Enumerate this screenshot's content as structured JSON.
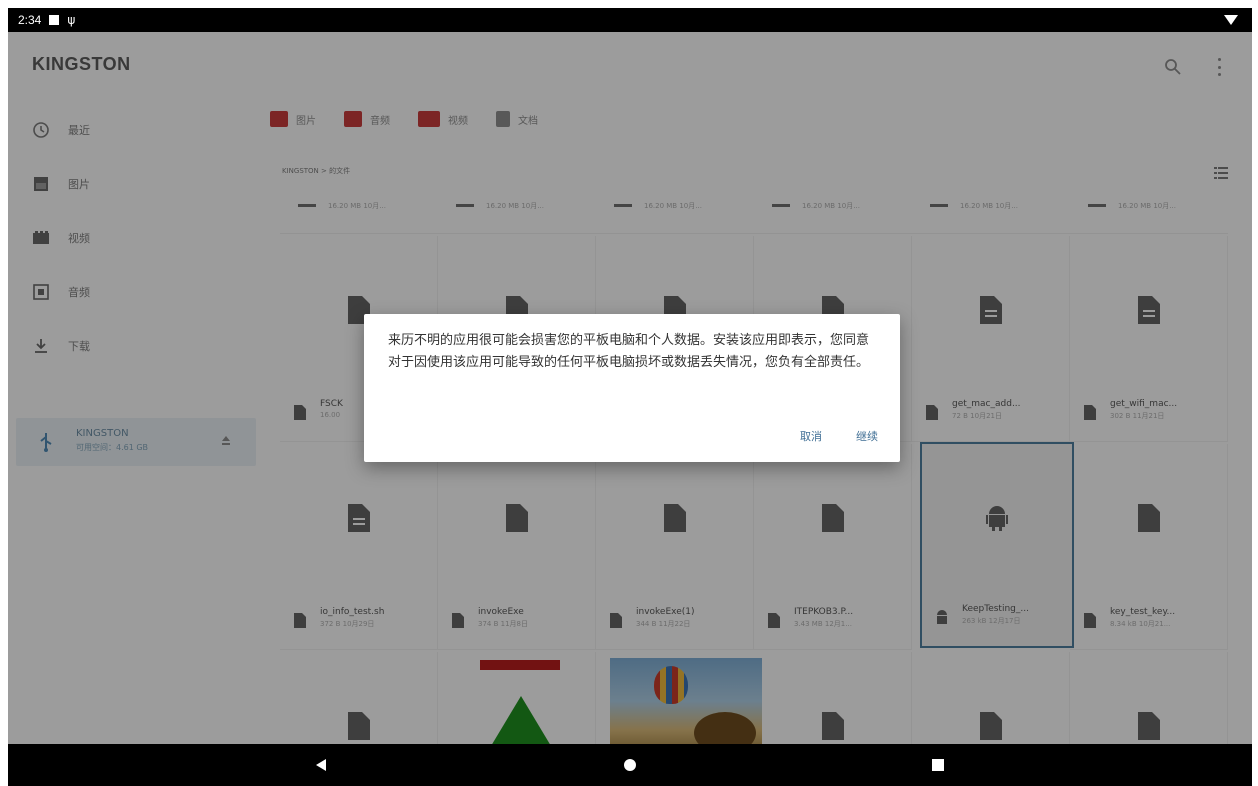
{
  "status_bar": {
    "time": "2:34"
  },
  "app": {
    "title": "KINGSTON"
  },
  "drawer": {
    "items": [
      {
        "label": "最近",
        "icon": "clock-icon"
      },
      {
        "label": "图片",
        "icon": "image-icon"
      },
      {
        "label": "视频",
        "icon": "video-icon"
      },
      {
        "label": "音频",
        "icon": "audio-icon"
      },
      {
        "label": "下载",
        "icon": "download-icon"
      }
    ],
    "root": {
      "name": "KINGSTON",
      "free": "可用空间：4.61 GB"
    }
  },
  "chips": [
    {
      "label": "图片",
      "icon": "image-icon",
      "color": "#c23b3b"
    },
    {
      "label": "音频",
      "icon": "audio-icon",
      "color": "#c23b3b"
    },
    {
      "label": "视频",
      "icon": "video-icon",
      "color": "#c23b3b"
    },
    {
      "label": "文档",
      "icon": "document-icon",
      "color": "#8a8a8a"
    }
  ],
  "breadcrumb": "KINGSTON > 的文件",
  "top_row_meta": [
    "16.20 MB 10月...",
    "16.20 MB 10月...",
    "16.20 MB 10月...",
    "16.20 MB 10月...",
    "16.20 MB 10月...",
    "16.20 MB 10月..."
  ],
  "files_row1": [
    {
      "name": "FSCK",
      "meta": "16.00",
      "icon": "document-icon"
    },
    {
      "name": "",
      "meta": "",
      "icon": "document-icon"
    },
    {
      "name": "",
      "meta": "",
      "icon": "document-icon"
    },
    {
      "name": "",
      "meta": "",
      "icon": "document-icon"
    },
    {
      "name": "get_mac_add...",
      "meta": "72 B 10月21日",
      "icon": "document-icon"
    },
    {
      "name": "get_wifi_mac...",
      "meta": "302 B 11月21日",
      "icon": "document-icon"
    }
  ],
  "files_row2": [
    {
      "name": "io_info_test.sh",
      "meta": "372 B 10月29日",
      "icon": "document-icon"
    },
    {
      "name": "invokeExe",
      "meta": "374 B 11月8日",
      "icon": "document-icon"
    },
    {
      "name": "invokeExe(1)",
      "meta": "344 B 11月22日",
      "icon": "document-icon"
    },
    {
      "name": "ITEPKOB3.P...",
      "meta": "3.43 MB 12月1...",
      "icon": "document-icon"
    },
    {
      "name": "KeepTesting_...",
      "meta": "263 kB 12月17日",
      "icon": "android-icon",
      "selected": true
    },
    {
      "name": "key_test_key...",
      "meta": "8.34 kB 10月21...",
      "icon": "document-icon"
    }
  ],
  "dialog": {
    "message": "来历不明的应用很可能会损害您的平板电脑和个人数据。安装该应用即表示，您同意对于因使用该应用可能导致的任何平板电脑损坏或数据丢失情况，您负有全部责任。",
    "cancel": "取消",
    "continue": "继续",
    "accent": "#3f6e94"
  }
}
